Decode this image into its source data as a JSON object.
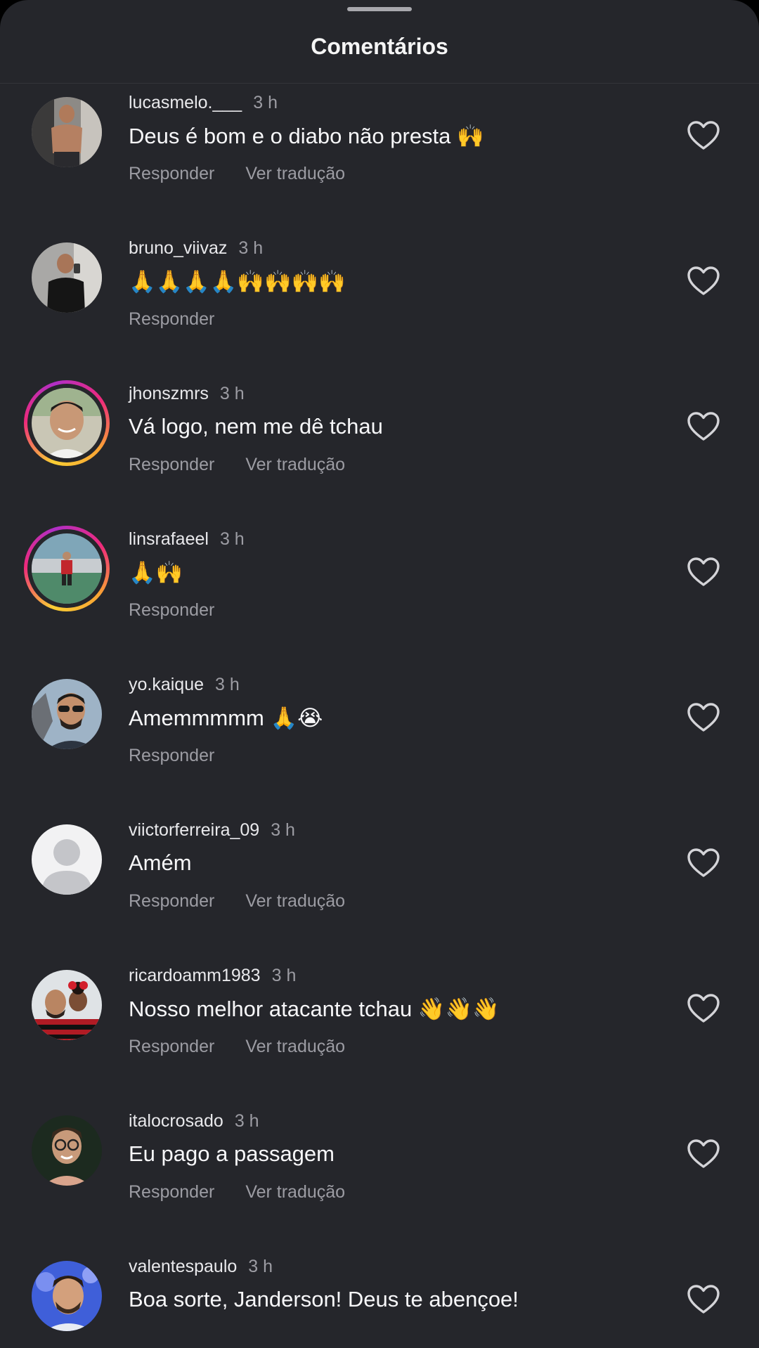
{
  "header": {
    "title": "Comentários"
  },
  "comments": [
    {
      "username": "lucasmelo.___",
      "time": "3 h",
      "text": "Deus é bom e o diabo não presta 🙌",
      "reply": "Responder",
      "translate": "Ver tradução"
    },
    {
      "username": "bruno_viivaz",
      "time": "3 h",
      "text": "🙏🙏🙏🙏🙌🙌🙌🙌",
      "reply": "Responder",
      "translate": ""
    },
    {
      "username": "jhonszmrs",
      "time": "3 h",
      "text": "Vá logo, nem me dê tchau",
      "reply": "Responder",
      "translate": "Ver tradução"
    },
    {
      "username": "linsrafaeel",
      "time": "3 h",
      "text": "🙏🙌",
      "reply": "Responder",
      "translate": ""
    },
    {
      "username": "yo.kaique",
      "time": "3 h",
      "text": "Amemmmmm 🙏😭",
      "reply": "Responder",
      "translate": ""
    },
    {
      "username": "viictorferreira_09",
      "time": "3 h",
      "text": "Amém",
      "reply": "Responder",
      "translate": "Ver tradução"
    },
    {
      "username": "ricardoamm1983",
      "time": "3 h",
      "text": "Nosso melhor atacante tchau 👋👋👋",
      "reply": "Responder",
      "translate": "Ver tradução"
    },
    {
      "username": "italocrosado",
      "time": "3 h",
      "text": "Eu pago a passagem",
      "reply": "Responder",
      "translate": "Ver tradução"
    },
    {
      "username": "valentespaulo",
      "time": "3 h",
      "text": "Boa sorte, Janderson! Deus te abençoe!",
      "reply": "",
      "translate": ""
    }
  ],
  "icons": {
    "like": "heart-outline-icon",
    "avatar_default": "default-user-icon"
  },
  "colors": {
    "background": "#25262b",
    "secondary_text": "#9c9ca3",
    "story_ring": "#ee2a7b"
  }
}
